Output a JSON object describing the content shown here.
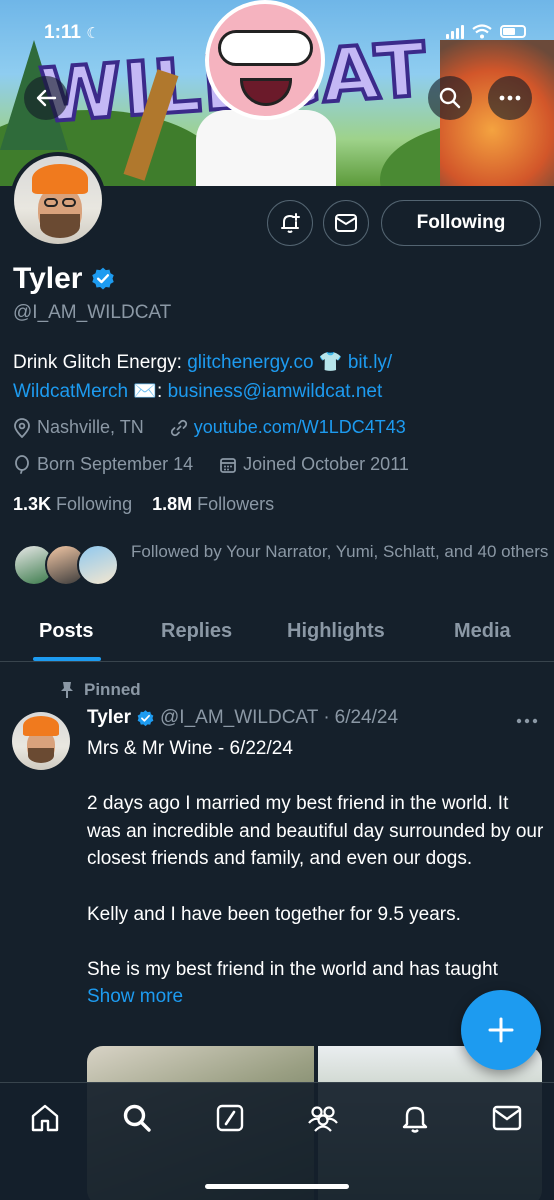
{
  "status_bar": {
    "time": "1:11"
  },
  "profile": {
    "name": "Tyler",
    "verified": true,
    "handle": "@I_AM_WILDCAT",
    "bio": {
      "prefix": "Drink Glitch Energy: ",
      "link1": "glitchenergy.co",
      "shirt_emoji": "👕",
      "link2a": "bit.ly/",
      "link2b": "WildcatMerch",
      "mail_emoji": "✉️",
      "colon": ":",
      "link3": "business@iamwildcat.net"
    },
    "location": "Nashville, TN",
    "website": "youtube.com/W1LDC4T43",
    "birthday": "Born September 14",
    "joined": "Joined October 2011",
    "following_count": "1.3K",
    "following_label": "Following",
    "followers_count": "1.8M",
    "followers_label": "Followers",
    "followed_by": "Followed by Your Narrator, Yumi, Schlatt, and 40 others"
  },
  "banner_text": "WILDCAT",
  "actions": {
    "following_label": "Following"
  },
  "tabs": [
    {
      "label": "Posts",
      "active": true
    },
    {
      "label": "Replies",
      "active": false
    },
    {
      "label": "Highlights",
      "active": false
    },
    {
      "label": "Media",
      "active": false
    }
  ],
  "post": {
    "pinned_label": "Pinned",
    "author": "Tyler",
    "handle": "@I_AM_WILDCAT",
    "separator": "·",
    "date": "6/24/24",
    "lines": [
      "Mrs & Mr Wine - 6/22/24",
      "",
      "2 days ago I married my best friend in the world. It was an incredible and beautiful day surrounded by our closest friends and family, and even our dogs.",
      "",
      "Kelly and I have been together for 9.5 years.",
      ""
    ],
    "last_line": "She is my best friend in the world and has taught ",
    "show_more": "Show more"
  },
  "colors": {
    "background": "#15202b",
    "accent": "#1d9bf0",
    "muted": "#8b98a5",
    "border": "#38444d"
  },
  "icons": {
    "back": "arrow-left-icon",
    "search": "search-icon",
    "more": "more-icon",
    "notify": "bell-plus-icon",
    "message": "mail-icon",
    "location": "location-pin-icon",
    "link": "link-icon",
    "birthday": "balloon-icon",
    "calendar": "calendar-icon",
    "pin": "pin-icon",
    "compose": "plus-icon",
    "nav": [
      "home-icon",
      "search-icon",
      "grok-icon",
      "communities-icon",
      "notifications-icon",
      "messages-icon"
    ]
  }
}
